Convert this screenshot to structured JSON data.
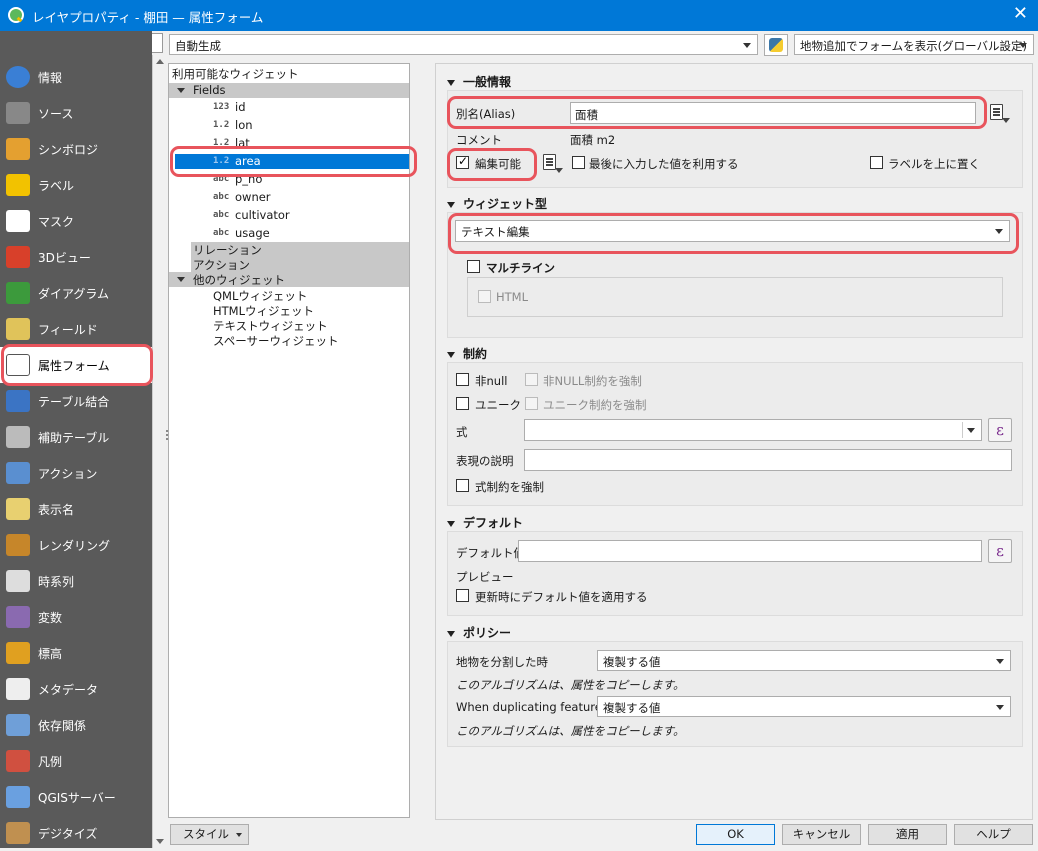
{
  "window": {
    "title": "レイヤプロパティ - 棚田 — 属性フォーム",
    "close": "✕"
  },
  "search": {
    "placeholder": ""
  },
  "sidebar": {
    "items": [
      {
        "label": "情報",
        "icon": "info-icon"
      },
      {
        "label": "ソース",
        "icon": "source-icon"
      },
      {
        "label": "シンボロジ",
        "icon": "symbology-icon"
      },
      {
        "label": "ラベル",
        "icon": "labels-icon"
      },
      {
        "label": "マスク",
        "icon": "mask-icon"
      },
      {
        "label": "3Dビュー",
        "icon": "3d-view-icon"
      },
      {
        "label": "ダイアグラム",
        "icon": "diagram-icon"
      },
      {
        "label": "フィールド",
        "icon": "fields-icon"
      },
      {
        "label": "属性フォーム",
        "icon": "attributes-form-icon",
        "active": true
      },
      {
        "label": "テーブル結合",
        "icon": "join-icon"
      },
      {
        "label": "補助テーブル",
        "icon": "auxiliary-storage-icon"
      },
      {
        "label": "アクション",
        "icon": "actions-icon"
      },
      {
        "label": "表示名",
        "icon": "display-icon"
      },
      {
        "label": "レンダリング",
        "icon": "rendering-icon"
      },
      {
        "label": "時系列",
        "icon": "temporal-icon"
      },
      {
        "label": "変数",
        "icon": "variables-icon"
      },
      {
        "label": "標高",
        "icon": "elevation-icon"
      },
      {
        "label": "メタデータ",
        "icon": "metadata-icon"
      },
      {
        "label": "依存関係",
        "icon": "dependencies-icon"
      },
      {
        "label": "凡例",
        "icon": "legend-icon"
      },
      {
        "label": "QGISサーバー",
        "icon": "qgis-server-icon"
      },
      {
        "label": "デジタイズ",
        "icon": "digitizing-icon"
      }
    ]
  },
  "toolbar": {
    "layout_mode": "自動生成",
    "form_suppress": "地物追加でフォームを表示(グローバル設定)"
  },
  "tree": {
    "header": "利用可能なウィジェット",
    "fields_label": "Fields",
    "fields": [
      {
        "type": "123",
        "name": "id"
      },
      {
        "type": "1.2",
        "name": "lon"
      },
      {
        "type": "1.2",
        "name": "lat"
      },
      {
        "type": "1.2",
        "name": "area",
        "selected": true
      },
      {
        "type": "abc",
        "name": "p_no"
      },
      {
        "type": "abc",
        "name": "owner"
      },
      {
        "type": "abc",
        "name": "cultivator"
      },
      {
        "type": "abc",
        "name": "usage"
      }
    ],
    "relations": "リレーション",
    "actions": "アクション",
    "other_widgets": "他のウィジェット",
    "other_items": [
      "QMLウィジェット",
      "HTMLウィジェット",
      "テキストウィジェット",
      "スペーサーウィジェット"
    ]
  },
  "general": {
    "title": "一般情報",
    "alias_label": "別名(Alias)",
    "alias_value": "面積",
    "comment_label": "コメント",
    "comment_value": "面積 m2",
    "editable_label": "編集可能",
    "reuse_label": "最後に入力した値を利用する",
    "label_on_top": "ラベルを上に置く"
  },
  "widget_type": {
    "title": "ウィジェット型",
    "value": "テキスト編集",
    "multiline": "マルチライン",
    "html": "HTML"
  },
  "constraints": {
    "title": "制約",
    "not_null": "非null",
    "enforce_not_null": "非NULL制約を強制",
    "unique": "ユニーク",
    "enforce_unique": "ユニーク制約を強制",
    "expression_label": "式",
    "expression_desc_label": "表現の説明",
    "enforce_expression": "式制約を強制",
    "epsilon": "ε"
  },
  "defaults": {
    "title": "デフォルト",
    "default_label": "デフォルト値",
    "preview_label": "プレビュー",
    "apply_on_update": "更新時にデフォルト値を適用する",
    "epsilon": "ε"
  },
  "policies": {
    "title": "ポリシー",
    "split_label": "地物を分割した時",
    "split_value": "複製する値",
    "split_note": "このアルゴリズムは、属性をコピーします。",
    "dup_label": "When duplicating features",
    "dup_value": "複製する値",
    "dup_note": "このアルゴリズムは、属性をコピーします。"
  },
  "buttons": {
    "style": "スタイル",
    "ok": "OK",
    "cancel": "キャンセル",
    "apply": "適用",
    "help": "ヘルプ"
  },
  "colors": {
    "accent": "#0078d7",
    "highlight": "#e8545c",
    "sidebar": "#5a5a5a"
  }
}
